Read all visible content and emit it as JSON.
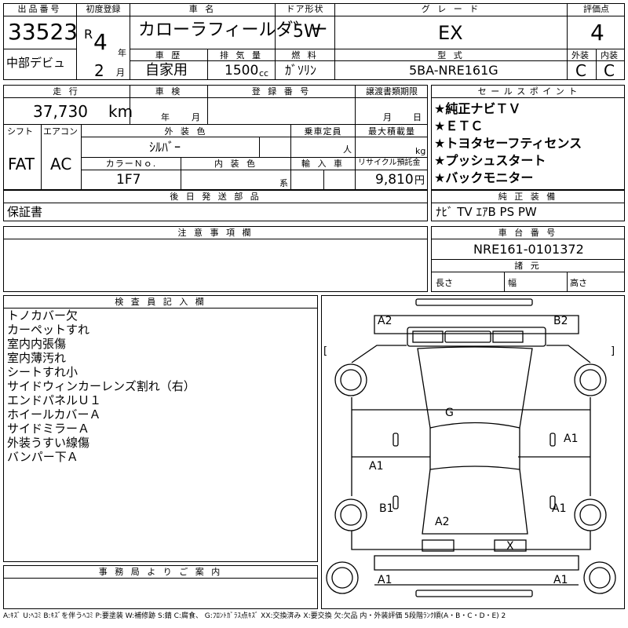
{
  "lot": {
    "label": "出品番号",
    "number": "33523",
    "debut": "中部デビュ"
  },
  "first_reg": {
    "label": "初度登録",
    "era": "R",
    "year": "4",
    "year_unit": "年",
    "month": "2",
    "month_unit": "月"
  },
  "car_name": {
    "label": "車 名",
    "value": "カローラフィールダ゛ー"
  },
  "door": {
    "label": "ドア形状",
    "value": "5W"
  },
  "grade": {
    "label": "グ レ ー ド",
    "value": "EX"
  },
  "score": {
    "label": "評価点",
    "value": "4",
    "ext_label": "外装",
    "int_label": "内装",
    "ext": "C",
    "int": "C"
  },
  "history": {
    "label": "車 歴",
    "value": "自家用"
  },
  "displacement": {
    "label": "排 気 量",
    "value": "1500",
    "unit": "cc"
  },
  "fuel": {
    "label": "燃 料",
    "value": "ｶﾞｿﾘﾝ"
  },
  "model_code": {
    "label": "型 式",
    "value": "5BA-NRE161G"
  },
  "mileage": {
    "label": "走 行",
    "value": "37,730",
    "unit": "km"
  },
  "inspection": {
    "label": "車 検",
    "year_unit": "年",
    "month_unit": "月"
  },
  "reg_no": {
    "label": "登 録 番 号"
  },
  "transfer": {
    "label": "譲渡書類期限",
    "month_unit": "月",
    "day_unit": "日"
  },
  "shift": {
    "label": "シフト",
    "value": "FAT"
  },
  "ac": {
    "label": "エアコン",
    "value": "AC"
  },
  "color": {
    "label": "外 装 色",
    "value": "ｼﾙﾊﾞｰ",
    "code_label": "カラーＮｏ.",
    "code": "1F7"
  },
  "interior": {
    "label": "内 装 色",
    "unit": "系"
  },
  "capacity": {
    "label": "乗車定員",
    "unit": "人"
  },
  "payload": {
    "label": "最大積載量",
    "unit": "kg"
  },
  "import": {
    "label": "輸 入 車"
  },
  "recycle": {
    "label": "リサイクル預託金",
    "value": "9,810",
    "unit": "円"
  },
  "sales_points": {
    "label": "セ ー ル ス ポ イ ン ト",
    "items": [
      "★純正ナビＴＶ",
      "★ＥＴＣ",
      "★トヨタセーフティセンス",
      "★プッシュスタート",
      "★バックモニター"
    ]
  },
  "later_parts": {
    "label": "後 日 発 送 部 品",
    "value": "保証書"
  },
  "equipment": {
    "label": "純 正 装 備",
    "value": "ﾅﾋﾞ TV ｴｱB PS PW"
  },
  "notes": {
    "label": "注 意 事 項 欄"
  },
  "chassis": {
    "label": "車 台 番 号",
    "value": "NRE161-0101372"
  },
  "specs": {
    "label": "諸 元",
    "length": "長さ",
    "width": "幅",
    "height": "高さ"
  },
  "inspector": {
    "label": "検 査 員 記 入 欄",
    "items": [
      "トノカバー欠",
      "カーペットすれ",
      "室内内張傷",
      "室内薄汚れ",
      "シートすれ小",
      "サイドウィンカーレンズ割れ（右）",
      "エンドパネルＵ１",
      "ホイールカバーＡ",
      "サイドミラーＡ",
      "外装うすい線傷",
      "バンパー下Ａ"
    ]
  },
  "office": {
    "label": "事 務 局 よ り ご 案 内"
  },
  "diagram_marks": {
    "a2_tl": "A2",
    "b2_tr": "B2",
    "g": "G",
    "a1_r": "A1",
    "a1_l": "A1",
    "b1": "B1",
    "a1_r2": "A1",
    "a2_rear": "A2",
    "x": "X",
    "a1_bl": "A1",
    "a1_br": "A1",
    "br_l": "[",
    "br_r": "]"
  },
  "legend": "A:ｷｽﾞ U:ﾍｺﾐ B:ｷｽﾞを伴うﾍｺﾐ P:要塗装 W:補修跡 S:錆 C:腐食、 G:ﾌﾛﾝﾄｶﾞﾗｽ点ｷｽﾞ XX:交換済み X:要交換 欠:欠品 内・外装評価 5段階ﾗﾝｸ順(A・B・C・D・E) 2"
}
